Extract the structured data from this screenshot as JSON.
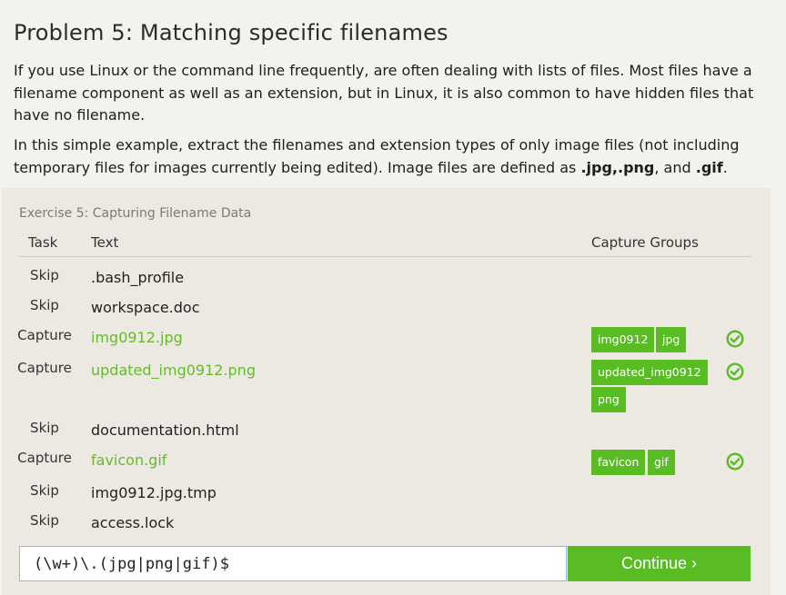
{
  "problem": {
    "title": "Problem 5: Matching specific filenames",
    "para1": "If you use Linux or the command line frequently, are often dealing with lists of files. Most files have a filename component as well as an extension, but in Linux, it is also common to have hidden files that have no filename.",
    "para2_prefix": "In this simple example, extract the filenames and extension types of only image files (not including temporary files for images currently being edited). Image files are defined as ",
    "ext_jpg": ".jpg",
    "ext_png": ",.png",
    "para2_and": ", and ",
    "ext_gif": ".gif",
    "para2_end": "."
  },
  "exercise": {
    "title": "Exercise 5: Capturing Filename Data",
    "headers": {
      "task": "Task",
      "text": "Text",
      "groups": "Capture Groups"
    },
    "rows": [
      {
        "task": "Skip",
        "text": ".bash_profile",
        "groups": []
      },
      {
        "task": "Skip",
        "text": "workspace.doc",
        "groups": []
      },
      {
        "task": "Capture",
        "text": "img0912.jpg",
        "groups": [
          "img0912",
          "jpg"
        ],
        "status": "check-icon"
      },
      {
        "task": "Capture",
        "text": "updated_img0912.png",
        "groups": [
          "updated_img0912",
          "png"
        ],
        "status": "check-icon"
      },
      {
        "task": "Skip",
        "text": "documentation.html",
        "groups": []
      },
      {
        "task": "Capture",
        "text": "favicon.gif",
        "groups": [
          "favicon",
          "gif"
        ],
        "status": "check-icon"
      },
      {
        "task": "Skip",
        "text": "img0912.jpg.tmp",
        "groups": []
      },
      {
        "task": "Skip",
        "text": "access.lock",
        "groups": []
      }
    ]
  },
  "input": {
    "value": "(\\w+)\\.(jpg|png|gif)$"
  },
  "continue_label": "Continue ›",
  "colors": {
    "accent": "#58bc22",
    "capture_text": "#68b92e",
    "background": "#f4f2ed",
    "panel": "#ebe9e2"
  }
}
